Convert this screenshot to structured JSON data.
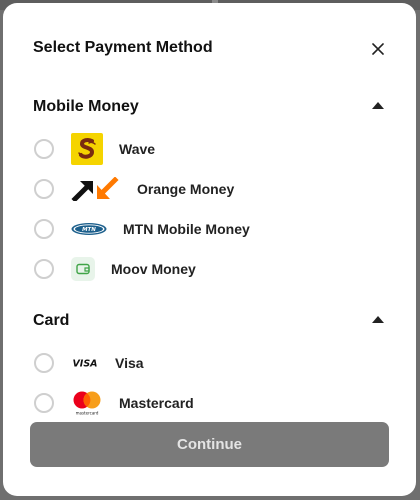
{
  "modal": {
    "title": "Select Payment Method"
  },
  "sections": {
    "mobile_money": {
      "title": "Mobile Money",
      "options": [
        {
          "label": "Wave",
          "icon": "wave-logo-icon"
        },
        {
          "label": "Orange Money",
          "icon": "orange-money-logo-icon"
        },
        {
          "label": "MTN Mobile Money",
          "icon": "mtn-logo-icon"
        },
        {
          "label": "Moov Money",
          "icon": "wallet-icon"
        }
      ]
    },
    "card": {
      "title": "Card",
      "options": [
        {
          "label": "Visa",
          "icon": "visa-logo-icon"
        },
        {
          "label": "Mastercard",
          "icon": "mastercard-logo-icon"
        }
      ]
    }
  },
  "logos": {
    "visa_text": "VISA",
    "mtn_text": "MTN",
    "mastercard_text": "mastercard"
  },
  "actions": {
    "continue_label": "Continue"
  },
  "colors": {
    "continue_bg": "#7a7a7a",
    "wave_yellow": "#f5d400",
    "wave_brown": "#7a2b10",
    "orange": "#ff7900",
    "mastercard_red": "#eb001b",
    "mastercard_orange": "#f79e1b",
    "moov_green": "#3fa447"
  }
}
